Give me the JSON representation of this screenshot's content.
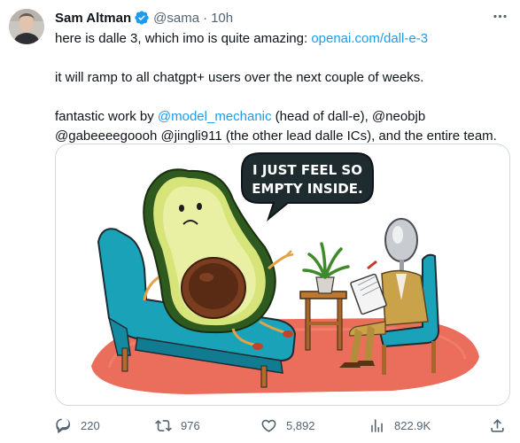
{
  "tweet": {
    "author_name": "Sam Altman",
    "handle": "@sama",
    "separator": "·",
    "timestamp": "10h",
    "paragraphs": [
      {
        "text_before": "here is dalle 3, which imo is quite amazing: ",
        "link": "openai.com/dall-e-3"
      },
      {
        "text": "it will ramp to all chatgpt+ users over the next couple of weeks."
      },
      {
        "prefix": "fantastic work by ",
        "mention": "@model_mechanic",
        "line1_rest": " (head of dall-e), @neobjb",
        "line2": "@gabeeeegoooh @jingli911 (the other lead dalle ICs), and the entire team."
      }
    ],
    "image": {
      "speech_line1": "I JUST FEEL SO",
      "speech_line2": "EMPTY INSIDE."
    },
    "actions": {
      "replies": "220",
      "reposts": "976",
      "likes": "5,892",
      "views": "822.9K"
    }
  },
  "colors": {
    "link": "#1d9bf0",
    "verified": "#1d9bf0",
    "muted_text": "#536471",
    "border": "#cfd9de"
  },
  "icons": {
    "verified": "verified-badge-icon",
    "more": "more-options-icon",
    "reply": "reply-icon",
    "repost": "repost-icon",
    "like": "like-icon",
    "views": "views-icon",
    "share": "share-icon"
  }
}
